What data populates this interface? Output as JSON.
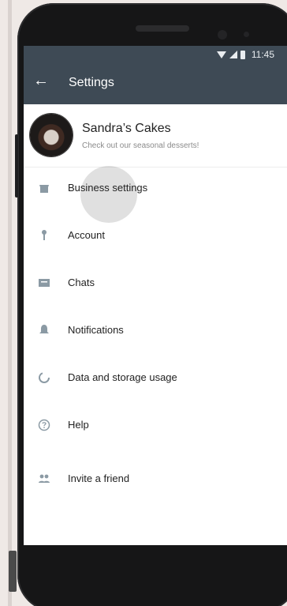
{
  "status_bar": {
    "time": "11:45",
    "icons": [
      "wifi-icon",
      "cellular-signal-icon",
      "battery-icon"
    ]
  },
  "app_bar": {
    "back_icon": "arrow-left-icon",
    "title": "Settings"
  },
  "profile": {
    "name": "Sandra’s Cakes",
    "status": "Check out our seasonal desserts!"
  },
  "menu": {
    "items": [
      {
        "label": "Business settings",
        "icon": "store-icon"
      },
      {
        "label": "Account",
        "icon": "key-icon"
      },
      {
        "label": "Chats",
        "icon": "chat-icon"
      },
      {
        "label": "Notifications",
        "icon": "bell-icon"
      },
      {
        "label": "Data and storage usage",
        "icon": "data-usage-icon"
      },
      {
        "label": "Help",
        "icon": "help-icon"
      },
      {
        "label": "Invite a friend",
        "icon": "people-icon"
      }
    ]
  },
  "colors": {
    "app_bar": "#3e4a55",
    "icon": "#8b9aa4"
  }
}
